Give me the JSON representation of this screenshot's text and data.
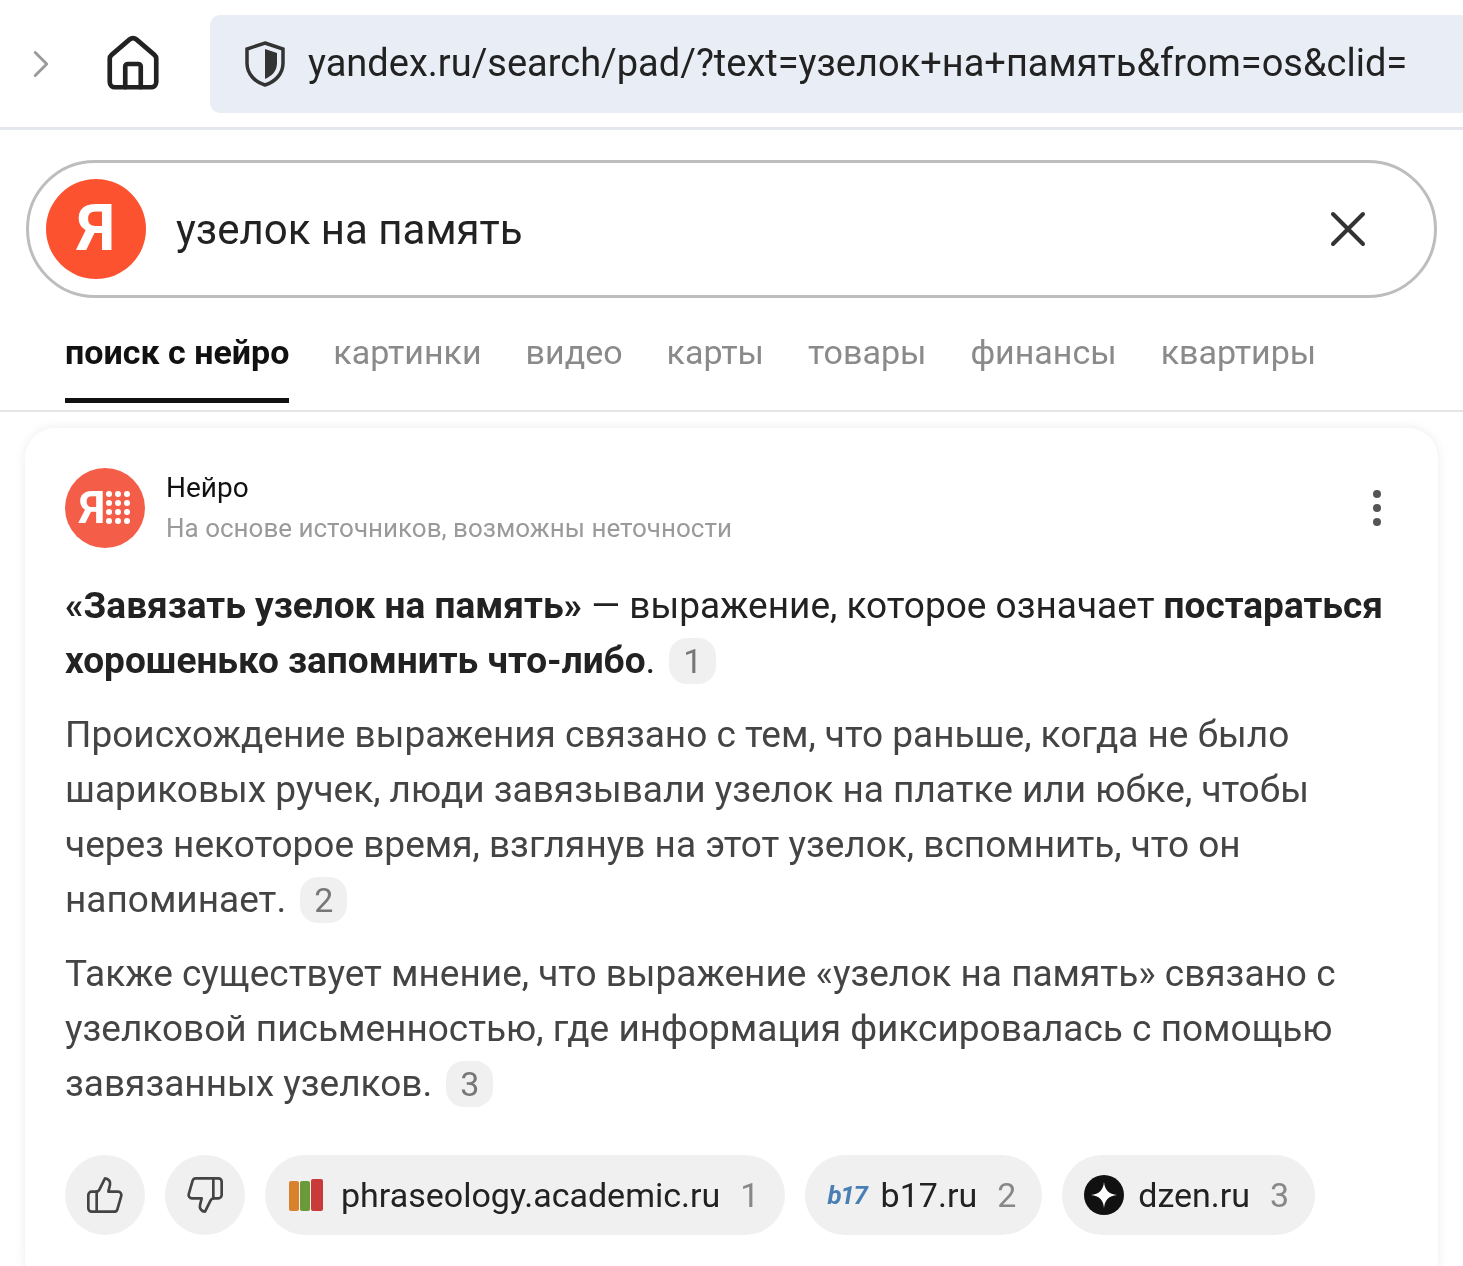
{
  "browser": {
    "url": "yandex.ru/search/pad/?text=узелок+на+память&from=os&clid="
  },
  "search": {
    "logo": "Я",
    "value": "узелок на память"
  },
  "tabs": [
    {
      "label": "поиск с нейро",
      "selected": true
    },
    {
      "label": "картинки",
      "selected": false
    },
    {
      "label": "видео",
      "selected": false
    },
    {
      "label": "карты",
      "selected": false
    },
    {
      "label": "товары",
      "selected": false
    },
    {
      "label": "финансы",
      "selected": false
    },
    {
      "label": "квартиры",
      "selected": false
    }
  ],
  "answer": {
    "logo": "Я",
    "title": "Нейро",
    "subtitle": "На основе источников, возможны неточности",
    "paragraphs": [
      {
        "text": "**«Завязать узелок на память»** — выражение, которое означает **постараться хорошенько запомнить что-либо**.",
        "ref": "1"
      },
      {
        "text": "Происхождение выражения связано с тем, что раньше, когда не было шариковых ручек, люди завязывали узелок на платке или юбке, чтобы через некоторое время, взглянув на этот узелок, вспомнить, что он напоминает.",
        "ref": "2"
      },
      {
        "text": "Также существует мнение, что выражение «узелок на память» связано с узелковой письменностью, где информация фиксировалась с помощью завязанных узелков.",
        "ref": "3"
      }
    ],
    "sources": [
      {
        "kind": "books",
        "name": "phraseology.academic.ru",
        "ref": "1"
      },
      {
        "kind": "b17",
        "logo": "b17",
        "name": "b17.ru",
        "ref": "2"
      },
      {
        "kind": "dzen",
        "name": "dzen.ru",
        "ref": "3"
      }
    ]
  }
}
